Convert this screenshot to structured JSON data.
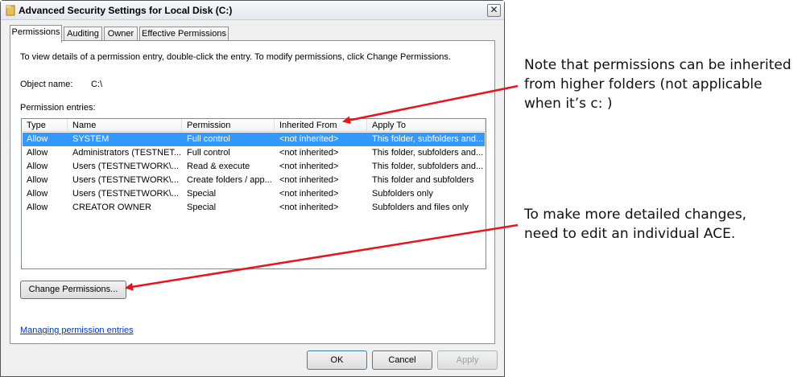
{
  "window": {
    "title": "Advanced Security Settings for Local Disk (C:)",
    "close_glyph": "✕"
  },
  "tabs": [
    {
      "label": "Permissions"
    },
    {
      "label": "Auditing"
    },
    {
      "label": "Owner"
    },
    {
      "label": "Effective Permissions"
    }
  ],
  "panel": {
    "instructions": "To view details of a permission entry, double-click the entry. To modify permissions, click Change Permissions.",
    "object_name_label": "Object name:",
    "object_name_value": "C:\\",
    "entries_label": "Permission entries:"
  },
  "table": {
    "columns": [
      "Type",
      "Name",
      "Permission",
      "Inherited From",
      "Apply To"
    ],
    "rows": [
      [
        "Allow",
        "SYSTEM",
        "Full control",
        "<not inherited>",
        "This folder, subfolders and..."
      ],
      [
        "Allow",
        "Administrators (TESTNET...",
        "Full control",
        "<not inherited>",
        "This folder, subfolders and..."
      ],
      [
        "Allow",
        "Users (TESTNETWORK\\...",
        "Read & execute",
        "<not inherited>",
        "This folder, subfolders and..."
      ],
      [
        "Allow",
        "Users (TESTNETWORK\\...",
        "Create folders / app...",
        "<not inherited>",
        "This folder and subfolders"
      ],
      [
        "Allow",
        "Users (TESTNETWORK\\...",
        "Special",
        "<not inherited>",
        "Subfolders only"
      ],
      [
        "Allow",
        "CREATOR OWNER",
        "Special",
        "<not inherited>",
        "Subfolders and files only"
      ]
    ],
    "selected_row": 0
  },
  "buttons": {
    "change_permissions": "Change Permissions...",
    "ok": "OK",
    "cancel": "Cancel",
    "apply": "Apply"
  },
  "link": {
    "managing": "Managing permission entries"
  },
  "annotations": {
    "note1": [
      "Note that permissions can be inherited",
      "from higher folders (not applicable",
      "when it’s c: )"
    ],
    "note2": [
      "To make more detailed changes,",
      "need to edit an individual ACE."
    ]
  },
  "colors": {
    "selection": "#3399ff",
    "arrow": "#e8141a",
    "link": "#0033cc"
  },
  "icons": {
    "title": "folder-icon",
    "close": "close-icon"
  }
}
